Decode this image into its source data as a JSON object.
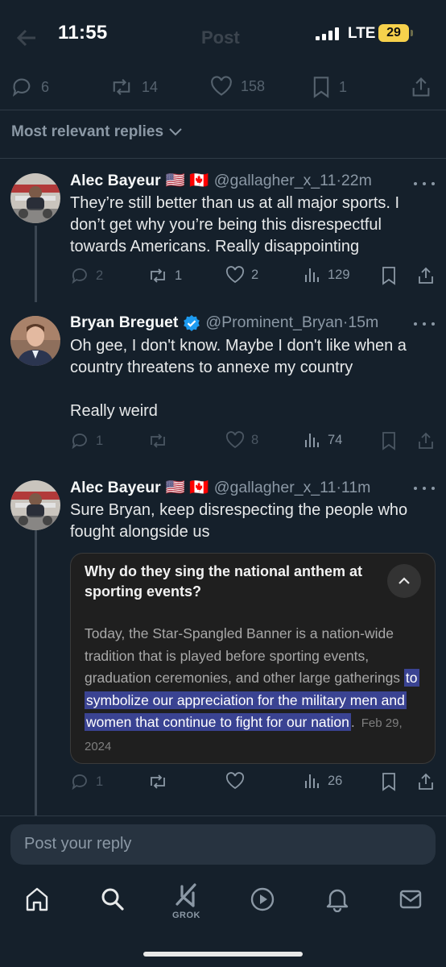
{
  "status": {
    "time": "11:55",
    "network": "LTE",
    "battery": "29"
  },
  "header": {
    "title": "Post"
  },
  "main_post_actions": {
    "replies": "6",
    "reposts": "14",
    "likes": "158",
    "bookmarks": "1"
  },
  "sort_label": "Most relevant replies",
  "replies": [
    {
      "name": "Alec Bayeur",
      "flags": "🇺🇸 🇨🇦",
      "handle": "@gallagher_x_11",
      "time": "·22m",
      "text": "They’re still better than us at all major sports. I don’t get why you’re being this disrespectful towards Americans. Really disappointing",
      "replies": "2",
      "reposts": "1",
      "likes": "2",
      "views": "129"
    },
    {
      "name": "Bryan Breguet",
      "verified": true,
      "handle": "@Prominent_Bryan",
      "time": "·15m",
      "text": "Oh gee, I don't know. Maybe I don't like when a country threatens to annexe my country\n\nReally weird",
      "replies": "1",
      "reposts": "",
      "likes": "8",
      "views": "74"
    },
    {
      "name": "Alec Bayeur",
      "flags": "🇺🇸 🇨🇦",
      "handle": "@gallagher_x_11",
      "time": "·11m",
      "text": "Sure Bryan, keep disrespecting the people who fought alongside us",
      "replies": "1",
      "reposts": "",
      "likes": "",
      "views": "26"
    }
  ],
  "quote_card": {
    "question": "Why do they sing the national anthem at sporting events?",
    "answer_plain": "Today, the Star-Spangled Banner is a nation-wide tradition that is played before sporting events, graduation ceremonies, and other large gatherings ",
    "answer_highlight": "to symbolize our appreciation for the military men and women that continue to fight for our nation",
    "answer_end": ".",
    "date": "Feb 29, 2024"
  },
  "reply_input": {
    "placeholder": "Post your reply"
  },
  "nav": {
    "grok_label": "GROK"
  },
  "colors": {
    "background": "#15202b",
    "highlight": "#3a4392",
    "verified": "#1d9bf0"
  }
}
